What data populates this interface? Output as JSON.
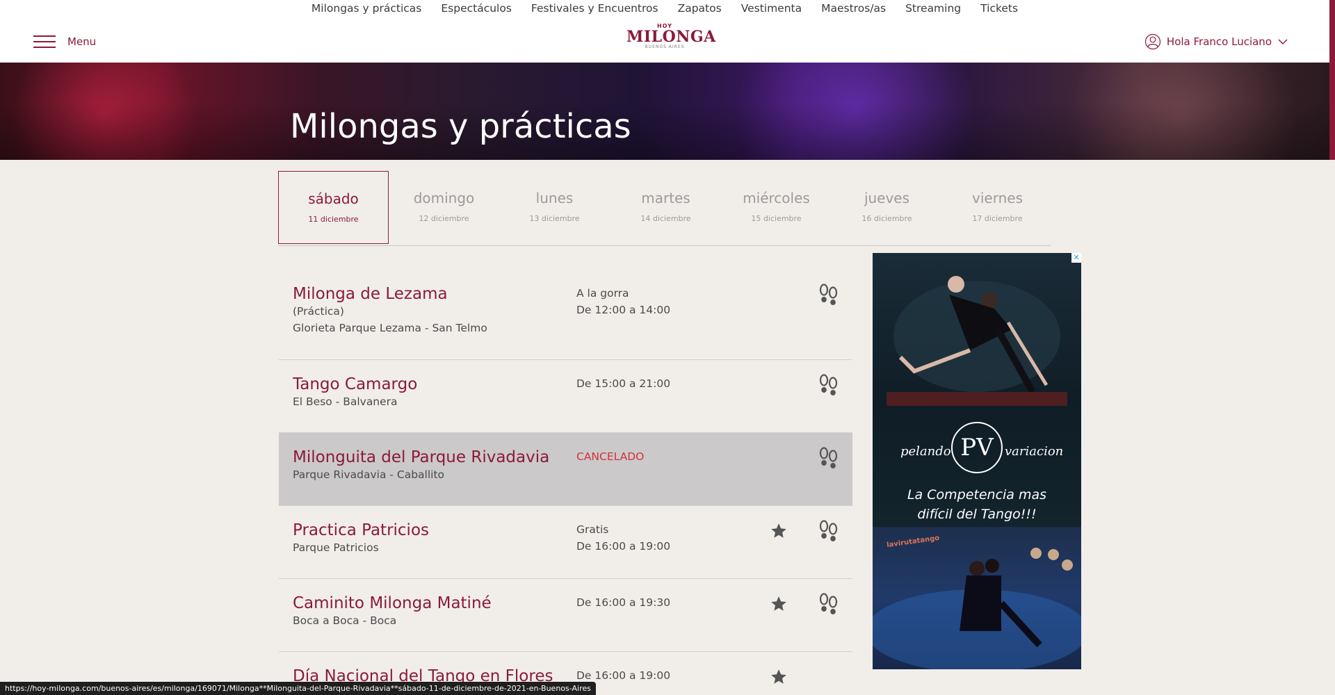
{
  "topnav": [
    "Milongas y prácticas",
    "Espectáculos",
    "Festivales y Encuentros",
    "Zapatos",
    "Vestimenta",
    "Maestros/as",
    "Streaming",
    "Tickets"
  ],
  "header": {
    "menu_label": "Menu",
    "logo": {
      "top": "HOY",
      "main": "MILONGA",
      "sub": "BUENOS AIRES"
    },
    "user_label": "Hola Franco Luciano"
  },
  "hero": {
    "title": "Milongas y prácticas"
  },
  "days": [
    {
      "name": "sábado",
      "date": "11 diciembre",
      "active": true
    },
    {
      "name": "domingo",
      "date": "12 diciembre",
      "active": false
    },
    {
      "name": "lunes",
      "date": "13 diciembre",
      "active": false
    },
    {
      "name": "martes",
      "date": "14 diciembre",
      "active": false
    },
    {
      "name": "miércoles",
      "date": "15 diciembre",
      "active": false
    },
    {
      "name": "jueves",
      "date": "16 diciembre",
      "active": false
    },
    {
      "name": "viernes",
      "date": "17 diciembre",
      "active": false
    }
  ],
  "events": [
    {
      "name": "Milonga de Lezama",
      "subs": [
        "(Práctica)",
        "Glorieta Parque Lezama - San Telmo"
      ],
      "info": [
        "A la gorra",
        "De 12:00 a 14:00"
      ],
      "cancelled": false,
      "star": false,
      "feet": true
    },
    {
      "name": "Tango Camargo",
      "subs": [
        "El Beso - Balvanera"
      ],
      "info": [
        "De 15:00 a 21:00"
      ],
      "cancelled": false,
      "star": false,
      "feet": true
    },
    {
      "name": "Milonguita del Parque Rivadavia",
      "subs": [
        "Parque Rivadavia - Caballito"
      ],
      "info": [
        "CANCELADO"
      ],
      "cancelled": true,
      "star": false,
      "feet": true
    },
    {
      "name": "Practica Patricios",
      "subs": [
        "Parque Patricios"
      ],
      "info": [
        "Gratis",
        "De 16:00 a 19:00"
      ],
      "cancelled": false,
      "star": true,
      "feet": true
    },
    {
      "name": "Caminito Milonga Matiné",
      "subs": [
        "Boca a Boca - Boca"
      ],
      "info": [
        "De 16:00 a 19:30"
      ],
      "cancelled": false,
      "star": true,
      "feet": true
    },
    {
      "name": "Día Nacional del Tango en Flores",
      "subs": [],
      "info": [
        "De 16:00 a 19:00"
      ],
      "cancelled": false,
      "star": true,
      "feet": false
    }
  ],
  "ad": {
    "brand_left": "pelando",
    "brand_mark": "PV",
    "brand_right": "variacion",
    "slogan": [
      "La Competencia mas",
      "difícil del Tango!!!"
    ],
    "tag": "lavirutatango"
  },
  "status_url": "https://hoy-milonga.com/buenos-aires/es/milonga/169071/Milonga**Milonguita-del-Parque-Rivadavia**sábado-11-de-diciembre-de-2021-en-Buenos-Aires",
  "colors": {
    "brand": "#8b1a38",
    "cancel": "#d0333a",
    "background": "#f1eeea",
    "cancelled_row": "#ccc9ca"
  }
}
